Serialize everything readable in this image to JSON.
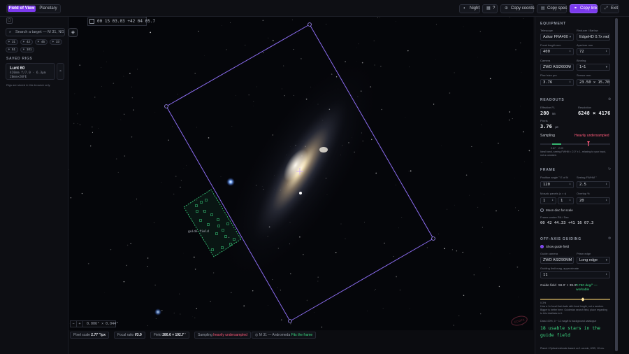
{
  "topbar": {
    "mode_tabs": [
      {
        "label": "Field of View",
        "active": true
      },
      {
        "label": "Planetary",
        "active": false
      }
    ],
    "night_label": "Night",
    "help_label": "?",
    "copy_coords_label": "Copy coords",
    "copy_spec_label": "Copy spec",
    "copy_link_label": "Copy link",
    "exit_label": "Exit"
  },
  "left": {
    "search_placeholder": "Search a target — M 31, NG",
    "chips": [
      "31",
      "42",
      "45",
      "33",
      "51",
      "101"
    ],
    "saved_rigs_label": "SAVED RIGS",
    "rig": {
      "name": "Lunt 60",
      "line1": "420mm  f/7.0  ·  6.3µm",
      "line2": "20mm×20FE"
    },
    "note": "Rigs are stored in this browser only."
  },
  "sky": {
    "coords": "00 15 03.03  +42 04 05.7",
    "zoom_text": "0.006° × 0.044°",
    "guide_field_label": "guide field",
    "watermark": "CCOPA"
  },
  "status": {
    "pixel_scale_label": "Pixel scale",
    "pixel_scale_value": "2.77 \"/px",
    "focal_ratio_label": "Focal ratio",
    "focal_ratio_value": "f/3.9",
    "field_label": "Field",
    "field_value": "280.6 × 192.7 '",
    "sampling_label": "Sampling",
    "sampling_value": "heavily undersampled",
    "target_text": "M 31 — Andromeda",
    "fit_text": "Fits the frame"
  },
  "right": {
    "equipment_label": "EQUIPMENT",
    "telescope_label": "Telescope",
    "telescope_value": "Askar FRA400",
    "reducer_label": "Reducer / Barlow",
    "reducer_value": "EdgeHD 0.7x red",
    "focal_length_label": "Focal length mm",
    "focal_length_value": "400",
    "aperture_label": "Aperture mm",
    "aperture_value": "72",
    "camera_label": "Camera",
    "camera_value": "ZWO ASI2600M",
    "binning_label": "Binning",
    "binning_value": "1×1",
    "pixel_size_label": "Pixel size µm",
    "pixel_size_value": "3.76",
    "sensor_label": "Sensor mm",
    "sensor_value": "23.50 × 15.70",
    "readouts_label": "READOUTS",
    "eff_fl_label": "Effective FL",
    "eff_fl_value": "280",
    "eff_fl_unit": "mm",
    "resolution_label": "Resolution",
    "resolution_value": "6248 × 4176",
    "resolution_unit": "px",
    "pixels_label": "Pixels",
    "pixels_value": "3.76",
    "pixels_unit": "µm",
    "sampling_label": "Sampling",
    "sampling_value": "Heavily undersampled",
    "sampling_ticks": [
      "0.67",
      "2.00"
    ],
    "sampling_note": "Ideal band, seeing FWHM ≈ 2.0\" ± 1, relaxing to your input, not a constant.",
    "frame_label": "FRAME",
    "position_angle_label": "Position angle ° E of N",
    "position_angle_value": "120",
    "seeing_label": "Seeing FWHM \"",
    "seeing_value": "2.5",
    "mosaic_label": "Mosaic panels (c × r)",
    "mosaic_cols": "1",
    "mosaic_rows": "1",
    "overlap_label": "Overlap %",
    "overlap_value": "20",
    "moon_label": "Moon disc for scale",
    "frame_centre_label": "Frame centre RA / Dec",
    "frame_centre_value": "00 42 44.33  +41 16 07.3",
    "offaxis_label": "OFF-AXIS GUIDING",
    "show_guide_label": "Show guide field",
    "guide_camera_label": "Guide camera",
    "guide_camera_value": "ZWO ASI290MM",
    "prism_label": "Prism edge",
    "prism_value": "Long edge",
    "guide_limit_label": "Guiding limit mag, approximate",
    "guide_limit_value": "11",
    "guide_field_label": "Guide field",
    "guide_field_value": "59.0' × 39.3'",
    "guide_rate_value": "0.750 deg/° —",
    "guide_rate_status": "workable",
    "guide_slider_ticks": [
      "0.3%",
      ""
    ],
    "guide_note": "How a 1x focal that rivals with focal length, not a random. Bigger is better here. Guidestar search field, place regarding to this trial/data to it.",
    "guide_note2": "Data 100%, 0 ~ 11 mag/it is background catalogue",
    "usable_stars_text": "18 usable stars in the guide field",
    "footer_note": "Planet / Optical estimate based on 1 arcmin, USD, 10 ms."
  },
  "colors": {
    "accent": "#7c3aed",
    "warn": "#ff5a7a",
    "ok": "#3ddc84",
    "fov_outline": "#8b6cf0",
    "guide_outline": "#3ddc84"
  }
}
